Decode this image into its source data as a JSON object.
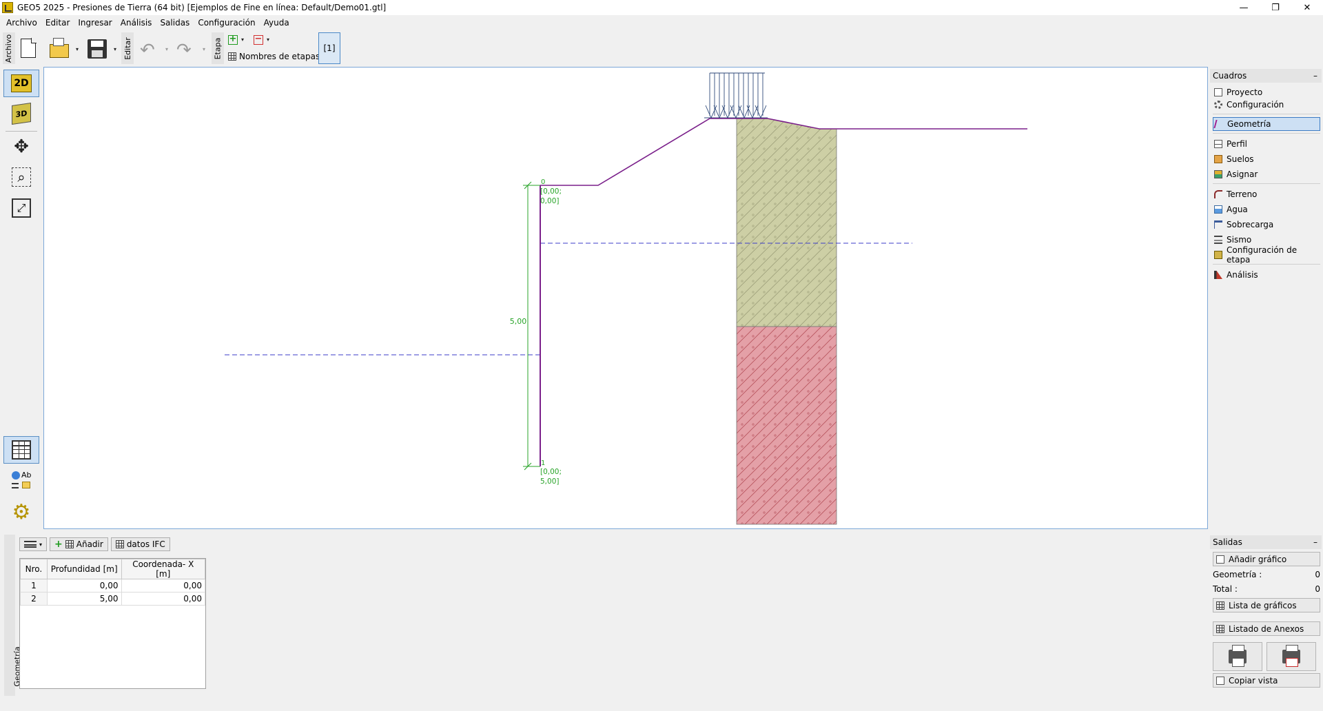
{
  "window": {
    "title": "GEO5 2025 - Presiones de Tierra (64 bit) [Ejemplos de Fine en línea: Default/Demo01.gtl]",
    "min_glyph": "—",
    "max_glyph": "❐",
    "close_glyph": "✕"
  },
  "menu": [
    "Archivo",
    "Editar",
    "Ingresar",
    "Análisis",
    "Salidas",
    "Configuración",
    "Ayuda"
  ],
  "toolbar": {
    "file_label": "Archivo",
    "edit_label": "Editar",
    "stage_label": "Etapa",
    "stage_names": "Nombres de etapas",
    "current_stage": "[1]",
    "caret": "▾",
    "undo_glyph": "↶",
    "redo_glyph": "↷",
    "add_glyph": "+",
    "remove_glyph": "−"
  },
  "left_tools": {
    "view_2d": "2D",
    "view_3d": "3D",
    "move_glyph": "✥",
    "zoom_glyph": "⌕",
    "fit_glyph": "⤢",
    "settings_glyph": "⚙",
    "labels_text": "Ab"
  },
  "drawing": {
    "depth_label": "5,00",
    "point_top_index": "0",
    "point_top_coord_1": "[0,00;",
    "point_top_coord_2": "0,00]",
    "point_bottom_index": "1",
    "point_bottom_coord_1": "[0,00;",
    "point_bottom_coord_2": "5,00]",
    "colors": {
      "wall": "#7a1f8a",
      "dimension": "#27a327",
      "water": "#3b3bc8",
      "soil_upper": "#cdcfa5",
      "soil_lower": "#e4a0a7",
      "surcharge": "#2f4a7a"
    }
  },
  "cuadros": {
    "title": "Cuadros",
    "collapse": "–",
    "items": [
      {
        "label": "Proyecto",
        "icon": "document-icon"
      },
      {
        "label": "Configuración",
        "icon": "gear-icon"
      },
      {
        "label": "Geometría",
        "icon": "geometry-icon"
      },
      {
        "label": "Perfil",
        "icon": "profile-icon"
      },
      {
        "label": "Suelos",
        "icon": "soil-icon"
      },
      {
        "label": "Asignar",
        "icon": "assign-icon"
      },
      {
        "label": "Terreno",
        "icon": "terrain-icon"
      },
      {
        "label": "Agua",
        "icon": "water-icon"
      },
      {
        "label": "Sobrecarga",
        "icon": "surcharge-icon"
      },
      {
        "label": "Sismo",
        "icon": "earthquake-icon"
      },
      {
        "label": "Configuración de etapa",
        "icon": "stage-settings-icon"
      },
      {
        "label": "Análisis",
        "icon": "analysis-icon"
      }
    ]
  },
  "bottom": {
    "side_label": "Geometría",
    "add_button": "Añadir",
    "ifc_button": "datos IFC",
    "table": {
      "headers": [
        "Nro.",
        "Profundidad [m]",
        "Coordenada- X [m]"
      ],
      "rows": [
        [
          "1",
          "0,00",
          "0,00"
        ],
        [
          "2",
          "5,00",
          "0,00"
        ]
      ]
    }
  },
  "salidas": {
    "title": "Salidas",
    "collapse": "–",
    "add_graph": "Añadir gráfico",
    "geometry_label": "Geometría :",
    "geometry_value": "0",
    "total_label": "Total :",
    "total_value": "0",
    "graph_list": "Lista de gráficos",
    "annex_list": "Listado de Anexos",
    "copy_view": "Copiar vista"
  }
}
